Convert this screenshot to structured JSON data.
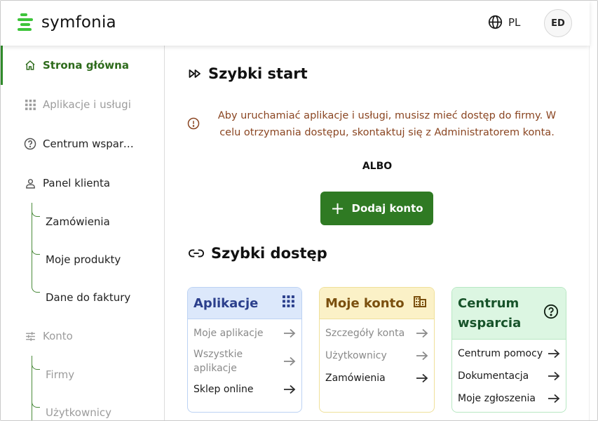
{
  "app": {
    "logo_text": "symfonia"
  },
  "header": {
    "language": "PL",
    "avatar_initials": "ED"
  },
  "sidebar": {
    "items": [
      {
        "label": "Strona główna",
        "icon": "home-icon",
        "state": "active"
      },
      {
        "label": "Aplikacje i usługi",
        "icon": "apps-grid-icon",
        "state": "disabled"
      },
      {
        "label": "Centrum wsparcia",
        "icon": "help-circle-icon",
        "state": "normal"
      },
      {
        "label": "Panel klienta",
        "icon": "user-icon",
        "state": "normal"
      },
      {
        "label": "Konto",
        "icon": "sliders-icon",
        "state": "disabled"
      }
    ],
    "panel_sub": [
      "Zamówienia",
      "Moje produkty",
      "Dane do faktury"
    ],
    "konto_sub": [
      "Firmy",
      "Użytkownicy"
    ]
  },
  "quick_start": {
    "title": "Szybki start",
    "warning": "Aby uruchamiać aplikacje i usługi, musisz mieć dostęp do firmy. W celu otrzymania dostępu, skontaktuj się z Administratorem konta.",
    "or_label": "ALBO",
    "add_button": "Dodaj konto"
  },
  "quick_access": {
    "title": "Szybki dostęp",
    "cards": [
      {
        "title": "Aplikacje",
        "icon": "apps-grid-icon",
        "colors": {
          "bg": "#dce8fb",
          "border": "#bcd2f3",
          "text": "#2b3f8c"
        },
        "links": [
          {
            "label": "Moje aplikacje",
            "muted": true
          },
          {
            "label": "Wszystkie aplikacje",
            "muted": true
          },
          {
            "label": "Sklep online",
            "muted": false
          }
        ]
      },
      {
        "title": "Moje konto",
        "icon": "building-icon",
        "colors": {
          "bg": "#fbf1c7",
          "border": "#efe09a",
          "text": "#7a4f0e"
        },
        "links": [
          {
            "label": "Szczegóły konta",
            "muted": true
          },
          {
            "label": "Użytkownicy",
            "muted": true
          },
          {
            "label": "Zamówienia",
            "muted": false
          }
        ]
      },
      {
        "title": "Centrum wsparcia",
        "icon": "help-circle-icon",
        "colors": {
          "bg": "#dcf6e2",
          "border": "#b8e8c3",
          "text": "#17532a"
        },
        "links": [
          {
            "label": "Centrum pomocy",
            "muted": false
          },
          {
            "label": "Dokumentacja",
            "muted": false
          },
          {
            "label": "Moje zgłoszenia",
            "muted": false
          }
        ]
      }
    ]
  }
}
